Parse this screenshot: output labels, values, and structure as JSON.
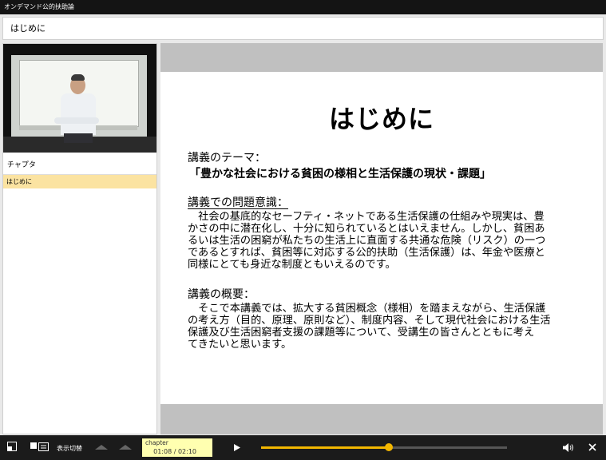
{
  "window": {
    "title": "オンデマンド公的扶助論"
  },
  "header": {
    "title": "はじめに"
  },
  "sidebar": {
    "chapter_heading": "チャプタ",
    "chapters": [
      {
        "label": "はじめに",
        "active": true
      }
    ]
  },
  "slide": {
    "title": "はじめに",
    "theme_label": "講義のテーマ：",
    "theme": "「豊かな社会における貧困の様相と生活保護の現状・課題」",
    "problem_label": "講義での問題意識：",
    "problem_lines": [
      "　社会の基底的なセーフティ・ネットである生活保護の仕組みや現実は、豊",
      "かさの中に潜在化し、十分に知られているとはいえません。しかし、貧困あ",
      "るいは生活の困窮が私たちの生活上に直面する共通な危険（リスク）の一つ",
      "であるとすれば、貧困等に対応する公的扶助（生活保護）は、年金や医療と",
      "同様にとても身近な制度ともいえるのです。"
    ],
    "overview_label": "講義の概要：",
    "overview_lines": [
      "　そこで本講義では、拡大する貧困概念（様相）を踏まえながら、生活保護",
      "の考え方（目的、原理、原則など）、制度内容、そして現代社会における生活",
      "保護及び生活困窮者支援の課題等について、受講生の皆さんとともに考え",
      "てきたいと思います。"
    ]
  },
  "controls": {
    "display_toggle_label": "表示切替",
    "chapter_label": "chapter",
    "time": "01:08 / 02:10",
    "progress": 0.52,
    "accent_color": "#f2b600"
  }
}
